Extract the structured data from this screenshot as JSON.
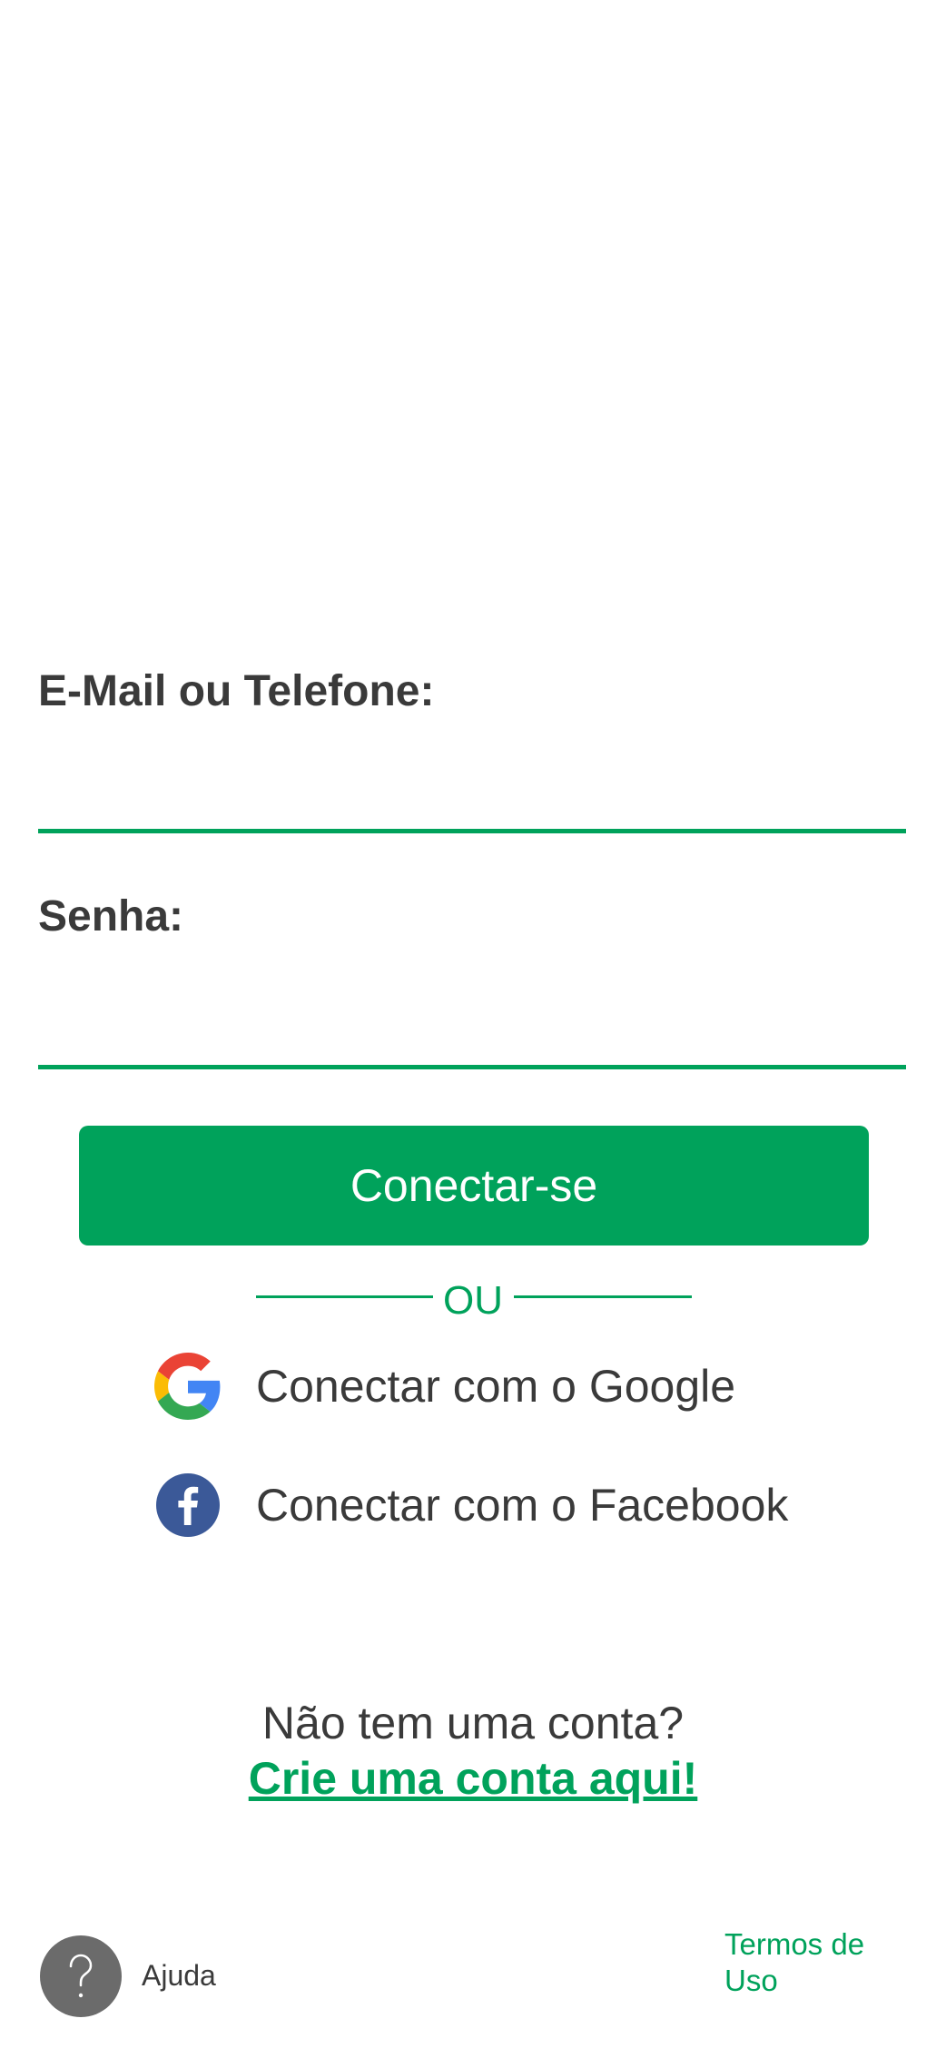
{
  "login": {
    "email_label": "E-Mail ou Telefone:",
    "email_value": "",
    "password_label": "Senha:",
    "password_value": "",
    "connect_label": "Conectar-se"
  },
  "divider": {
    "text": "OU"
  },
  "social": {
    "google_label": "Conectar com o Google",
    "google_icon": "google-g-icon",
    "facebook_label": "Conectar com o Facebook",
    "facebook_icon": "facebook-f-icon"
  },
  "signup": {
    "question": "Não tem uma conta?",
    "link": "Crie uma conta aqui!"
  },
  "footer": {
    "help_label": "Ajuda",
    "help_icon": "question-mark-icon",
    "terms_label": "Termos de Uso"
  },
  "colors": {
    "accent": "#00a25b",
    "text": "#3a3a3a",
    "facebook": "#3b5998",
    "help_icon_bg": "#6b6b6b"
  }
}
